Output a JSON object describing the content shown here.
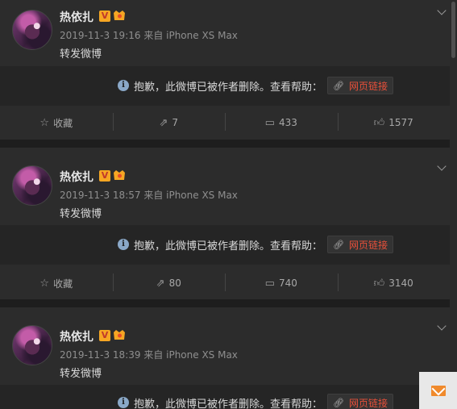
{
  "posts": [
    {
      "username": "热依扎",
      "vip_badge": "V",
      "meta": "2019-11-3 19:16 来自 iPhone XS Max",
      "text": "转发微博",
      "notice": "抱歉，此微博已被作者删除。查看帮助：",
      "link_label": "网页链接",
      "favorite_label": "收藏",
      "repost_count": "7",
      "comment_count": "433",
      "like_count": "1577"
    },
    {
      "username": "热依扎",
      "vip_badge": "V",
      "meta": "2019-11-3 18:57 来自 iPhone XS Max",
      "text": "转发微博",
      "notice": "抱歉，此微博已被作者删除。查看帮助：",
      "link_label": "网页链接",
      "favorite_label": "收藏",
      "repost_count": "80",
      "comment_count": "740",
      "like_count": "3140"
    },
    {
      "username": "热依扎",
      "vip_badge": "V",
      "meta": "2019-11-3 18:39 来自 iPhone XS Max",
      "text": "转发微博",
      "notice": "抱歉，此微博已被作者删除。查看帮助：",
      "link_label": "网页链接"
    }
  ],
  "icons": {
    "info": "info-icon",
    "link": "link-icon",
    "favorite": "star-icon",
    "repost": "repost-icon",
    "comment": "comment-icon",
    "like": "thumbs-up-icon",
    "message": "mail-icon"
  },
  "colors": {
    "background": "#1e1e1e",
    "card": "#2c2c2c",
    "link": "#e8503a",
    "badge": "#f6a623",
    "message_button": "#f08a2c"
  }
}
